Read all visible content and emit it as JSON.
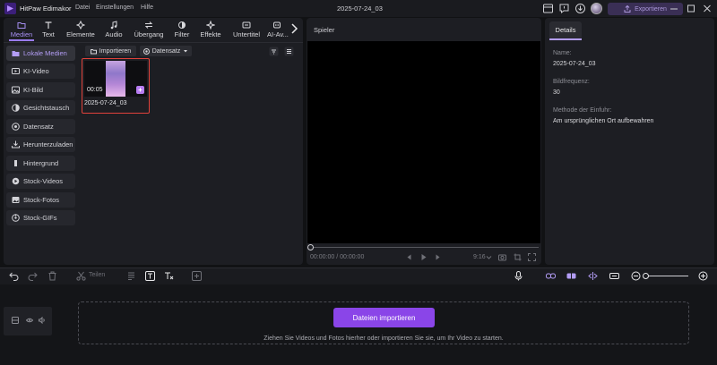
{
  "app": {
    "title": "HitPaw Edimakor",
    "menu": [
      "Datei",
      "Einstellungen",
      "Hilfe"
    ],
    "document_title": "2025-07-24_03",
    "export_label": "Exportieren"
  },
  "toolbar_tabs": [
    {
      "label": "Medien",
      "icon": "folder-icon",
      "active": true
    },
    {
      "label": "Text",
      "icon": "text-icon"
    },
    {
      "label": "Elemente",
      "icon": "shapes-icon"
    },
    {
      "label": "Audio",
      "icon": "music-icon"
    },
    {
      "label": "Übergang",
      "icon": "transition-icon"
    },
    {
      "label": "Filter",
      "icon": "filter-icon"
    },
    {
      "label": "Effekte",
      "icon": "sparkle-icon"
    },
    {
      "label": "Untertitel",
      "icon": "subtitle-icon"
    },
    {
      "label": "AI-Av...",
      "icon": "ai-icon"
    }
  ],
  "sidebar": [
    {
      "label": "Lokale Medien",
      "icon": "folder-icon",
      "active": true
    },
    {
      "label": "KI-Video",
      "icon": "video-icon"
    },
    {
      "label": "KI-Bild",
      "icon": "image-icon"
    },
    {
      "label": "Gesichtstausch",
      "icon": "face-icon"
    },
    {
      "label": "Datensatz",
      "icon": "dataset-icon"
    },
    {
      "label": "Herunterzuladen",
      "icon": "download-icon"
    },
    {
      "label": "Hintergrund",
      "icon": "background-icon"
    },
    {
      "label": "Stock-Videos",
      "icon": "stock-video-icon"
    },
    {
      "label": "Stock-Fotos",
      "icon": "stock-photo-icon"
    },
    {
      "label": "Stock-GIFs",
      "icon": "gif-icon"
    }
  ],
  "media": {
    "import_label": "Importieren",
    "dataset_label": "Datensatz",
    "items": [
      {
        "name": "2025-07-24_03",
        "duration": "00:05"
      }
    ]
  },
  "preview": {
    "label": "Spieler",
    "timecode": "00:00:00 / 00:00:00",
    "zoom": "9:16"
  },
  "details": {
    "tab": "Details",
    "fields": [
      {
        "label": "Name:",
        "value": "2025-07-24_03"
      },
      {
        "label": "Bildfrequenz:",
        "value": "30"
      },
      {
        "label": "Methode der Einfuhr:",
        "value": "Am ursprünglichen Ort aufbewahren"
      }
    ]
  },
  "timeline": {
    "split_label": "Teilen",
    "import_button": "Dateien importieren",
    "drop_hint": "Ziehen Sie Videos und Fotos hierher oder importieren Sie sie, um Ihr Video zu starten.",
    "zoom_level": 0.05
  },
  "colors": {
    "accent": "#8a45e8",
    "accent_light": "#b39df5",
    "selection": "#e0423b",
    "background": "#111214"
  }
}
